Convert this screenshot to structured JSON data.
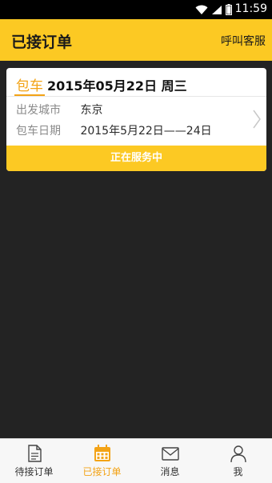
{
  "status_bar": {
    "time": "11:59",
    "icons": [
      "wifi-icon",
      "signal-icon",
      "battery-icon"
    ]
  },
  "app_bar": {
    "title": "已接订单",
    "action_label": "呼叫客服"
  },
  "order_card": {
    "badge": "包车",
    "title": "2015年05月22日 周三",
    "rows": [
      {
        "label": "出发城市",
        "value": "东京"
      },
      {
        "label": "包车日期",
        "value": "2015年5月22日——24日"
      }
    ],
    "status": "正在服务中"
  },
  "tabs": [
    {
      "label": "待接订单",
      "icon": "document-icon",
      "active": false
    },
    {
      "label": "已接订单",
      "icon": "calendar-icon",
      "active": true
    },
    {
      "label": "消息",
      "icon": "envelope-icon",
      "active": false
    },
    {
      "label": "我",
      "icon": "person-icon",
      "active": false
    }
  ],
  "colors": {
    "accent": "#fcc923",
    "highlight": "#f3a316",
    "background": "#232323"
  }
}
